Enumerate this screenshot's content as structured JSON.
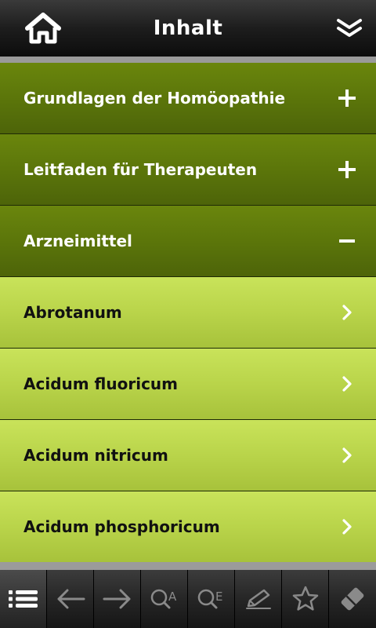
{
  "header": {
    "title": "Inhalt",
    "home_icon": "home-icon",
    "collapse_icon": "double-chevron-down-icon"
  },
  "sections": [
    {
      "label": "Grundlagen der Homöopathie",
      "state": "collapsed",
      "icon": "plus-icon"
    },
    {
      "label": "Leitfaden für Therapeuten",
      "state": "collapsed",
      "icon": "plus-icon"
    },
    {
      "label": "Arzneimittel",
      "state": "expanded",
      "icon": "minus-icon"
    }
  ],
  "items": [
    {
      "label": "Abrotanum",
      "icon": "chevron-right-icon"
    },
    {
      "label": "Acidum fluoricum",
      "icon": "chevron-right-icon"
    },
    {
      "label": "Acidum nitricum",
      "icon": "chevron-right-icon"
    },
    {
      "label": "Acidum phosphoricum",
      "icon": "chevron-right-icon"
    }
  ],
  "toolbar": {
    "items": [
      {
        "icon": "list-icon",
        "active": true
      },
      {
        "icon": "back-arrow-icon"
      },
      {
        "icon": "forward-arrow-icon"
      },
      {
        "icon": "search-a-icon",
        "letter": "A"
      },
      {
        "icon": "search-e-icon",
        "letter": "E"
      },
      {
        "icon": "pencil-icon"
      },
      {
        "icon": "star-icon"
      },
      {
        "icon": "eraser-icon"
      }
    ]
  },
  "colors": {
    "section_dark": "#5a740a",
    "item_light": "#b9d44a",
    "bar_dark": "#1d1d1d"
  }
}
